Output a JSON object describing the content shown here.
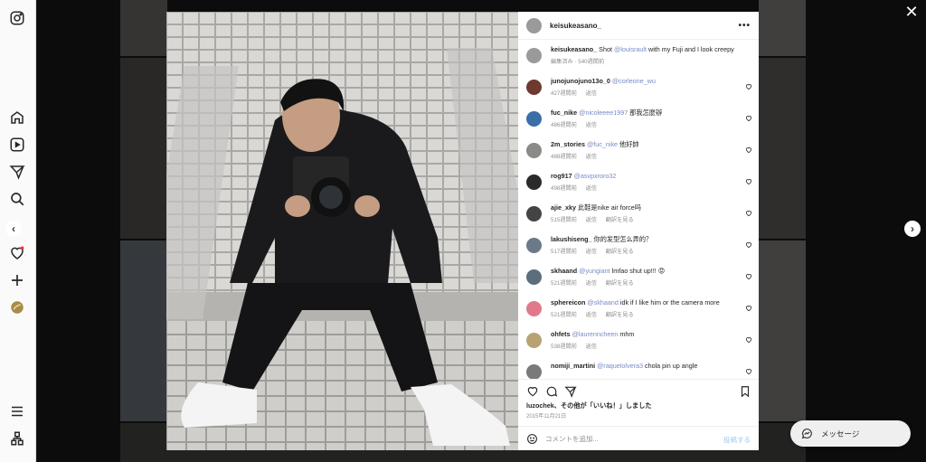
{
  "app": {
    "name": "Instagram"
  },
  "post": {
    "author": "keisukeasano_",
    "caption": {
      "user": "keisukeasano_",
      "text_before": "Shot",
      "mention": "@louisrault",
      "text_after": "with my Fuji and I look creepy",
      "meta": "編集済み · 540週間前"
    },
    "likes_user": "luzochek",
    "likes_text": "、その他が「いいね！」しました",
    "date": "2015年11月21日"
  },
  "comments": [
    {
      "user": "junojunojuno13o_0",
      "mention": "@corleone_wu",
      "text": "",
      "time": "427週間前",
      "reply": "返信",
      "translate": "",
      "avatar": "#6e3a2f"
    },
    {
      "user": "fuc_nike",
      "mention": "@nicoleeee1997",
      "text": "那我怎麼辦",
      "time": "486週間前",
      "reply": "返信",
      "translate": "",
      "avatar": "#3c6ea8"
    },
    {
      "user": "2m_stories",
      "mention": "@fuc_nike",
      "text": "他好帥",
      "time": "488週間前",
      "reply": "返信",
      "translate": "",
      "avatar": "#8a8a86"
    },
    {
      "user": "rog917",
      "mention": "@asvpxroro32",
      "text": "",
      "time": "498週間前",
      "reply": "返信",
      "translate": "",
      "avatar": "#2a2a2a"
    },
    {
      "user": "ajie_xky",
      "mention": "",
      "text": "此鞋是nike air force吗",
      "time": "515週間前",
      "reply": "返信",
      "translate": "翻訳を見る",
      "avatar": "#444444"
    },
    {
      "user": "lakushiseng_",
      "mention": "",
      "text": "你的发型怎么弄的？",
      "time": "517週間前",
      "reply": "返信",
      "translate": "翻訳を見る",
      "avatar": "#6a7a88"
    },
    {
      "user": "skhaand",
      "mention": "@yungiant",
      "text": "lmfao shut up!!! 😡",
      "time": "521週間前",
      "reply": "返信",
      "translate": "翻訳を見る",
      "avatar": "#5a6e7e"
    },
    {
      "user": "sphereicon",
      "mention": "@skhaand",
      "text": "idk if I like him or the camera more",
      "time": "521週間前",
      "reply": "返信",
      "translate": "翻訳を見る",
      "avatar": "#e07a8a"
    },
    {
      "user": "ohfets",
      "mention": "@laurenncheen",
      "text": "mhm",
      "time": "538週間前",
      "reply": "返信",
      "translate": "",
      "avatar": "#b8a274"
    },
    {
      "user": "nomiji_martini",
      "mention": "@raquelolvera3",
      "text": "chola pin up angle",
      "time": "",
      "reply": "",
      "translate": "",
      "avatar": "#7a7a7a"
    }
  ],
  "comment_box": {
    "placeholder": "コメントを追加...",
    "post_label": "投稿する"
  },
  "messages": {
    "label": "メッセージ"
  },
  "colors": {
    "accent": "#0095f6",
    "mention": "#4a63b5",
    "muted": "#8e8e8e"
  }
}
